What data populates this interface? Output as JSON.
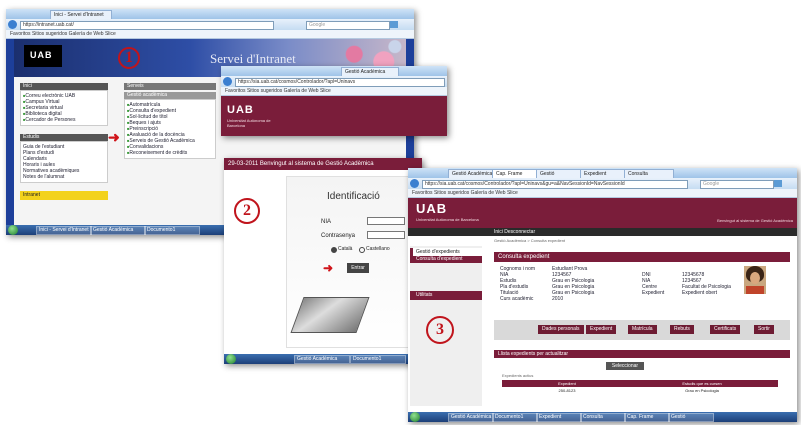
{
  "screenshot1": {
    "tab_title": "Inici - Servei d'Intranet",
    "address": "https://intranet.uab.cat/",
    "search_placeholder": "Google",
    "fav_text": "Favoritos   Sitios sugeridos   Galería de Web Slice",
    "logo": "UAB",
    "banner_title": "Servei d'Intranet",
    "step_number": "1",
    "col1_header": "Inici",
    "col1_items": [
      "Correu electrònic UAB",
      "Campus Virtual",
      "Secretaria virtual",
      "Biblioteca digital",
      "Cercador de Persones"
    ],
    "col1_box2_header": "Estudis",
    "col1_box2_items": [
      "Guia de l'estudiant",
      "Plans d'estudi",
      "Calendaris",
      "Horaris i aules",
      "Normatives acadèmiques",
      "Notes de l'alumnat"
    ],
    "col1_yellow": "Intranet",
    "col2_header": "Serveis",
    "col2_sub": "Gestió acadèmica",
    "col2_items": [
      "Automatrícula",
      "Consulta d'expedient",
      "Sol·licitud de títol",
      "Beques i ajuts",
      "Preinscripció",
      "Avaluació de la docència",
      "Serveis de Gestió Acadèmica",
      "Convalidacions",
      "Reconeixement de crèdits"
    ],
    "taskbar_items": [
      "Inici - Servei d'Intranet",
      "Gestió Acadèmica",
      "Documento1"
    ]
  },
  "screenshot2_header": {
    "tab_title": "Gestió Acadèmica",
    "address": "https://sia.uab.cat/cosmos/Controlador/?apl=Uninavs",
    "fav_text": "Favoritos   Sitios sugeridos   Galería de Web Slice",
    "logo": "UAB",
    "logo_sub": "Universitat Autònoma de Barcelona"
  },
  "screenshot2": {
    "date_bar": "29-03-2011   Benvingut al sistema de Gestió Acadèmica",
    "step_number": "2",
    "login_title": "Identificació",
    "nia_label": "NIA",
    "password_label": "Contrasenya",
    "lang_opt1": "Català",
    "lang_opt2": "Castellano",
    "submit_label": "Entrar",
    "taskbar_items": [
      "Gestió Acadèmica",
      "Documento1"
    ]
  },
  "screenshot3": {
    "tabs": [
      "Gestió Acadèmica",
      "Cap. Frame",
      "Gestió",
      "Expedient",
      "Consulta"
    ],
    "address": "https://sia.uab.cat/cosmos/Controlador/?apl=Uninavs&gu=a&NavSessionId=NavSessionId",
    "search_placeholder": "Google",
    "fav_text": "Favoritos   Sitios sugeridos   Galería de Web Slice",
    "logo": "UAB",
    "logo_sub": "Universitat Autònoma de Barcelona",
    "right_header_text": "Benvingut al sistema de Gestió Acadèmica",
    "nav_text": "Inici   Desconnectar",
    "breadcrumb": "Gestió Acadèmica > Consulta expedient",
    "side_items": [
      "Gestió d'expedients",
      "Consulta d'expedient",
      "Utilitats"
    ],
    "step_number": "3",
    "panel_title": "Consulta expedient",
    "fields_left": [
      {
        "label": "Cognoms i nom",
        "value": "Estudiant Prova"
      },
      {
        "label": "NIA",
        "value": "1234567"
      },
      {
        "label": "Estudis",
        "value": "Grau en Psicologia"
      },
      {
        "label": "Pla d'estudis",
        "value": "Grau en Psicologia"
      },
      {
        "label": "Titulació",
        "value": "Grau en Psicologia"
      },
      {
        "label": "Curs acadèmic",
        "value": "2010"
      }
    ],
    "fields_right": [
      {
        "label": "DNI",
        "value": "12345678"
      },
      {
        "label": "NIA",
        "value": "1234567"
      },
      {
        "label": "Centre",
        "value": "Facultat de Psicologia"
      },
      {
        "label": "Expedient",
        "value": "Expedient obert"
      }
    ],
    "action_buttons": [
      "Dades personals",
      "Expedient",
      "Matrícula",
      "Rebuts",
      "Certificats",
      "Sortir"
    ],
    "expedient_title": "Llista expedients per actualitzar",
    "select_button": "Seleccionar",
    "table_caption": "Expedients actius",
    "table_headers": [
      "Expedient",
      "Estudis que es cursen"
    ],
    "table_rows": [
      [
        "250-8123",
        "Grau en Psicologia"
      ]
    ],
    "taskbar_items": [
      "Gestió Acadèmica",
      "Documento1",
      "Expedient",
      "Consulta",
      "Cap. Frame",
      "Gestió"
    ]
  }
}
